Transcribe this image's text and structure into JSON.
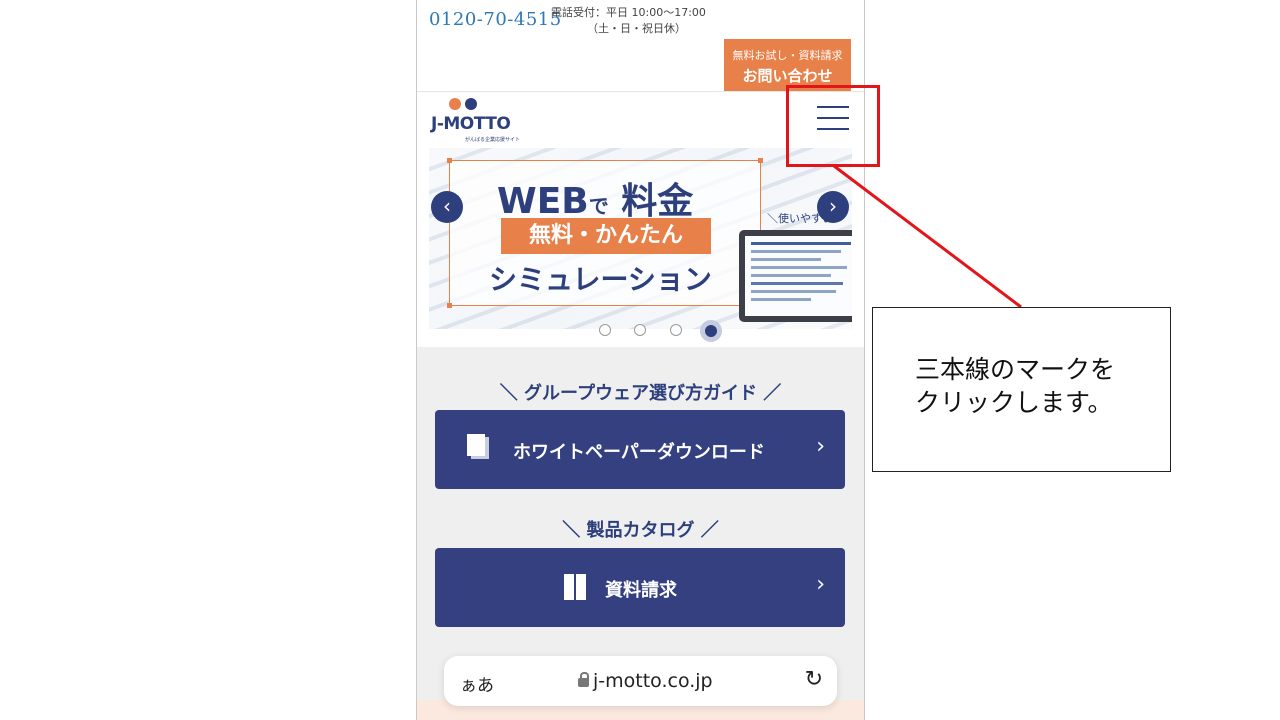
{
  "header": {
    "phone_number": "0120-70-4515",
    "hours_line1": "電話受付：平日 10:00〜17:00",
    "hours_line2": "（土・日・祝日休）",
    "contact_sub": "無料お試し・資料請求",
    "contact_main": "お問い合わせ"
  },
  "logo": {
    "text": "J-MOTTO",
    "tagline": "がんばる企業応援サイト",
    "colors": [
      "#e8804a",
      "#2d3f7c"
    ]
  },
  "banner": {
    "title_main": "WEB",
    "title_particle": "で",
    "title_tail": "料金",
    "ribbon": "無料・かんたん",
    "subtitle": "シミュレーション",
    "side_text": "＼使いやすい",
    "slide_count": 4,
    "active_slide": 4,
    "prev_icon": "chevron-left-icon",
    "next_icon": "chevron-right-icon"
  },
  "sections": [
    {
      "heading": "＼ グループウェア選び方ガイド ／",
      "button_label": "ホワイトペーパーダウンロード",
      "icon": "document-icon"
    },
    {
      "heading": "＼ 製品カタログ ／",
      "button_label": "資料請求",
      "icon": "catalog-icon"
    }
  ],
  "browser": {
    "text_size_label": "ぁあ",
    "url": "j-motto.co.jp",
    "reload_icon": "reload-icon"
  },
  "annotation": {
    "callout_text": "三本線のマークを\nクリックします。",
    "highlight_color": "#e3151a"
  },
  "colors": {
    "brand_navy": "#34407f",
    "brand_orange": "#e8804a",
    "phone_blue": "#2f78b6"
  }
}
